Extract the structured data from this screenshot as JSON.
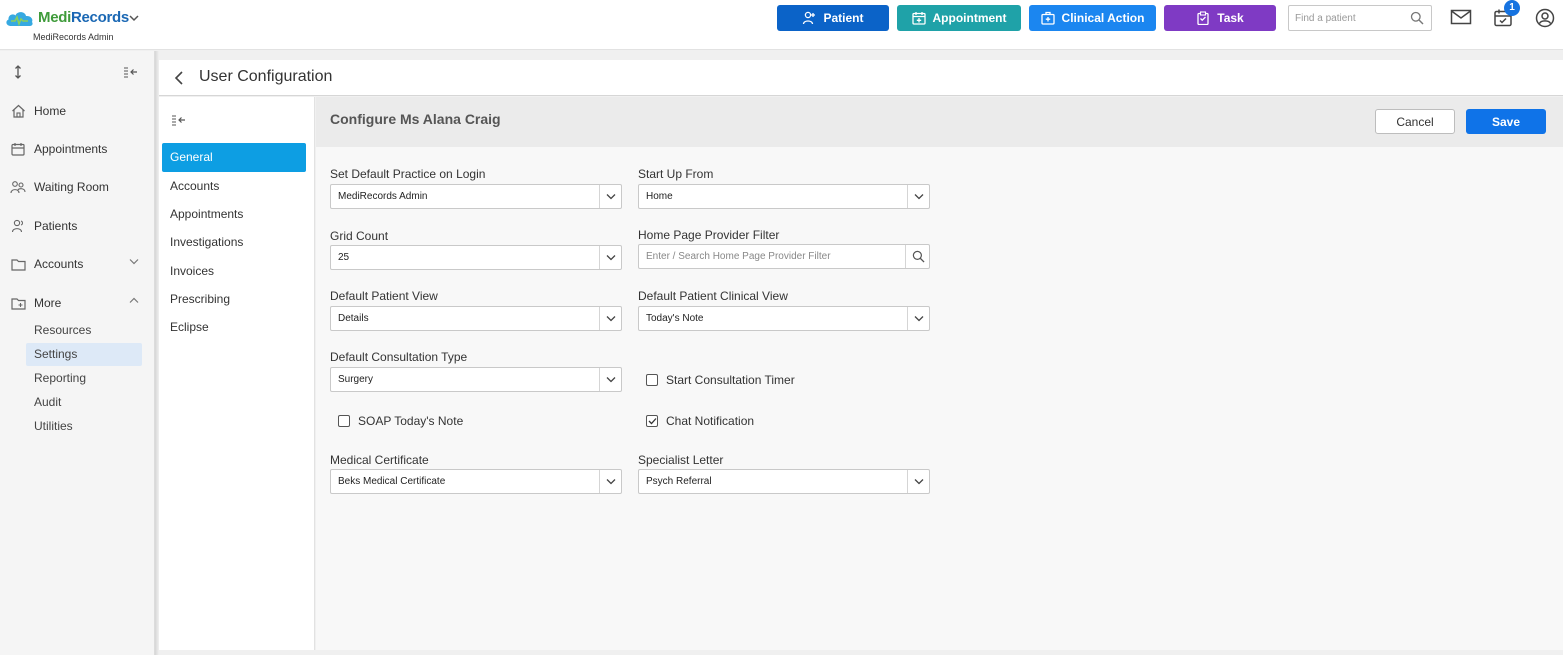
{
  "brand": {
    "name_part1": "Medi",
    "name_part2": "Records",
    "practice": "MediRecords Admin"
  },
  "topbar": {
    "buttons": [
      {
        "label": "Patient",
        "icon": "add-person-icon",
        "color": "#0b63c8"
      },
      {
        "label": "Appointment",
        "icon": "calendar-plus-icon",
        "color": "#1fa2a8"
      },
      {
        "label": "Clinical Action",
        "icon": "medical-case-icon",
        "color": "#1b86f0"
      },
      {
        "label": "Task",
        "icon": "clipboard-icon",
        "color": "#7f3ac4"
      }
    ],
    "search_placeholder": "Find a patient",
    "notification_count": "1"
  },
  "leftnav": {
    "items": [
      {
        "label": "Home",
        "icon": "home-icon"
      },
      {
        "label": "Appointments",
        "icon": "calendar-icon"
      },
      {
        "label": "Waiting Room",
        "icon": "people-icon"
      },
      {
        "label": "Patients",
        "icon": "person-icon"
      },
      {
        "label": "Accounts",
        "icon": "folder-icon"
      },
      {
        "label": "More",
        "icon": "folder-plus-icon"
      }
    ],
    "subitems": [
      "Resources",
      "Settings",
      "Reporting",
      "Audit",
      "Utilities"
    ],
    "active_subitem": "Settings"
  },
  "page": {
    "title": "User Configuration"
  },
  "subnav": {
    "items": [
      "General",
      "Accounts",
      "Appointments",
      "Investigations",
      "Invoices",
      "Prescribing",
      "Eclipse"
    ],
    "active": "General"
  },
  "form": {
    "title": "Configure Ms Alana Craig",
    "cancel_label": "Cancel",
    "save_label": "Save",
    "fields": {
      "default_practice": {
        "label": "Set Default Practice on Login",
        "value": "MediRecords Admin"
      },
      "start_up_from": {
        "label": "Start Up From",
        "value": "Home"
      },
      "grid_count": {
        "label": "Grid Count",
        "value": "25"
      },
      "provider_filter": {
        "label": "Home Page Provider Filter",
        "placeholder": "Enter / Search Home Page Provider Filter"
      },
      "patient_view": {
        "label": "Default Patient View",
        "value": "Details"
      },
      "clinical_view": {
        "label": "Default Patient Clinical View",
        "value": "Today's Note"
      },
      "consultation_type": {
        "label": "Default Consultation Type",
        "value": "Surgery"
      },
      "medical_certificate": {
        "label": "Medical Certificate",
        "value": "Beks Medical Certificate"
      },
      "specialist_letter": {
        "label": "Specialist Letter",
        "value": "Psych Referral"
      }
    },
    "checkboxes": {
      "start_consultation_timer": {
        "label": "Start Consultation Timer",
        "checked": false
      },
      "soap_todays_note": {
        "label": "SOAP Today's Note",
        "checked": false
      },
      "chat_notification": {
        "label": "Chat Notification",
        "checked": true
      }
    }
  }
}
